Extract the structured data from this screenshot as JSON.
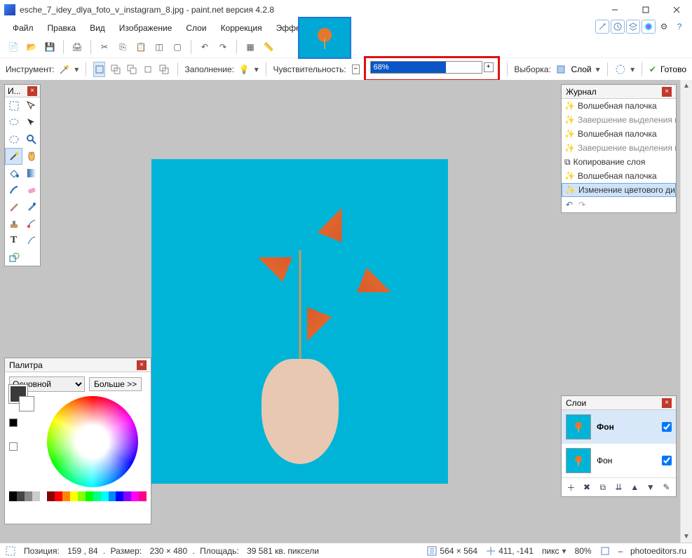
{
  "titlebar": {
    "filename": "esche_7_idey_dlya_foto_v_instagram_8.jpg",
    "app": "paint.net версия 4.2.8"
  },
  "menu": [
    "Файл",
    "Правка",
    "Вид",
    "Изображение",
    "Слои",
    "Коррекция",
    "Эффекты"
  ],
  "toolbar2": {
    "instrument_label": "Инструмент:",
    "fill_label": "Заполнение:",
    "tolerance_label": "Чувствительность:",
    "tolerance_value": "68%",
    "sample_label": "Выборка:",
    "sample_mode": "Слой",
    "commit_label": "Готово"
  },
  "tools_title": "И...",
  "history": {
    "title": "Журнал",
    "items": [
      {
        "label": "Волшебная палочка",
        "type": "normal"
      },
      {
        "label": "Завершение выделения палочкой",
        "type": "grey"
      },
      {
        "label": "Волшебная палочка",
        "type": "normal"
      },
      {
        "label": "Завершение выделения палочкой",
        "type": "grey"
      },
      {
        "label": "Копирование слоя",
        "type": "normal"
      },
      {
        "label": "Волшебная палочка",
        "type": "normal"
      },
      {
        "label": "Изменение цветового диапазона",
        "type": "sel"
      }
    ]
  },
  "layers": {
    "title": "Слои",
    "rows": [
      {
        "name": "Фон",
        "checked": true,
        "selected": true
      },
      {
        "name": "Фон",
        "checked": true,
        "selected": false
      }
    ]
  },
  "palette": {
    "title": "Палитра",
    "mode": "Основной",
    "more": "Больше >>"
  },
  "status": {
    "pos_label": "Позиция:",
    "pos": "159 , 84",
    "size_label": "Размер:",
    "size": "230   × 480",
    "area_label": "Площадь:",
    "area": "39 581 кв. пиксели",
    "canvas_dims": "564 × 564",
    "cursor": "411, -141",
    "units": "пикс",
    "zoom": "80%",
    "site": "photoeditors.ru"
  }
}
